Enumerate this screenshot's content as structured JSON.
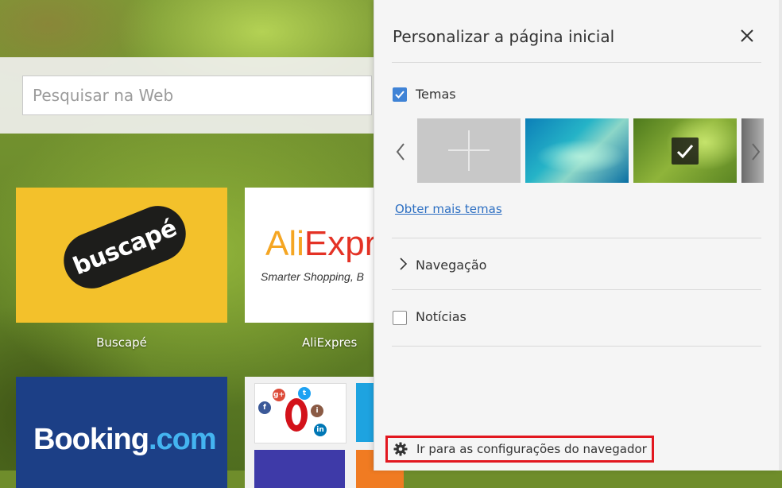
{
  "search": {
    "placeholder": "Pesquisar na Web"
  },
  "speed_dial": {
    "tiles": [
      {
        "logo_text": "buscapé",
        "caption": "Buscapé"
      },
      {
        "logo_main_a": "Ali",
        "logo_main_b": "Expre",
        "logo_sub": "Smarter Shopping, B",
        "caption": "AliExpres"
      },
      {
        "logo_main_a": "Booking",
        "logo_main_b": ".com"
      },
      {
        "icons": [
          "g+",
          "t",
          "f",
          "i",
          "in"
        ]
      }
    ]
  },
  "panel": {
    "title": "Personalizar a página inicial",
    "themes": {
      "label": "Temas",
      "checked": true,
      "more_link": "Obter mais temas"
    },
    "navigation": {
      "label": "Navegação"
    },
    "news": {
      "label": "Notícias",
      "checked": false
    },
    "settings_link": "Ir para as configurações do navegador"
  },
  "colors": {
    "accent": "#3f83d6",
    "link": "#2d6fc2",
    "highlight_border": "#e2171f"
  },
  "icons": {
    "close": "close-icon",
    "arrow_left": "chevron-left-icon",
    "arrow_right": "chevron-right-icon",
    "add": "plus-icon",
    "check": "check-icon",
    "gear": "gear-icon",
    "nav": "chevron-right-icon"
  }
}
